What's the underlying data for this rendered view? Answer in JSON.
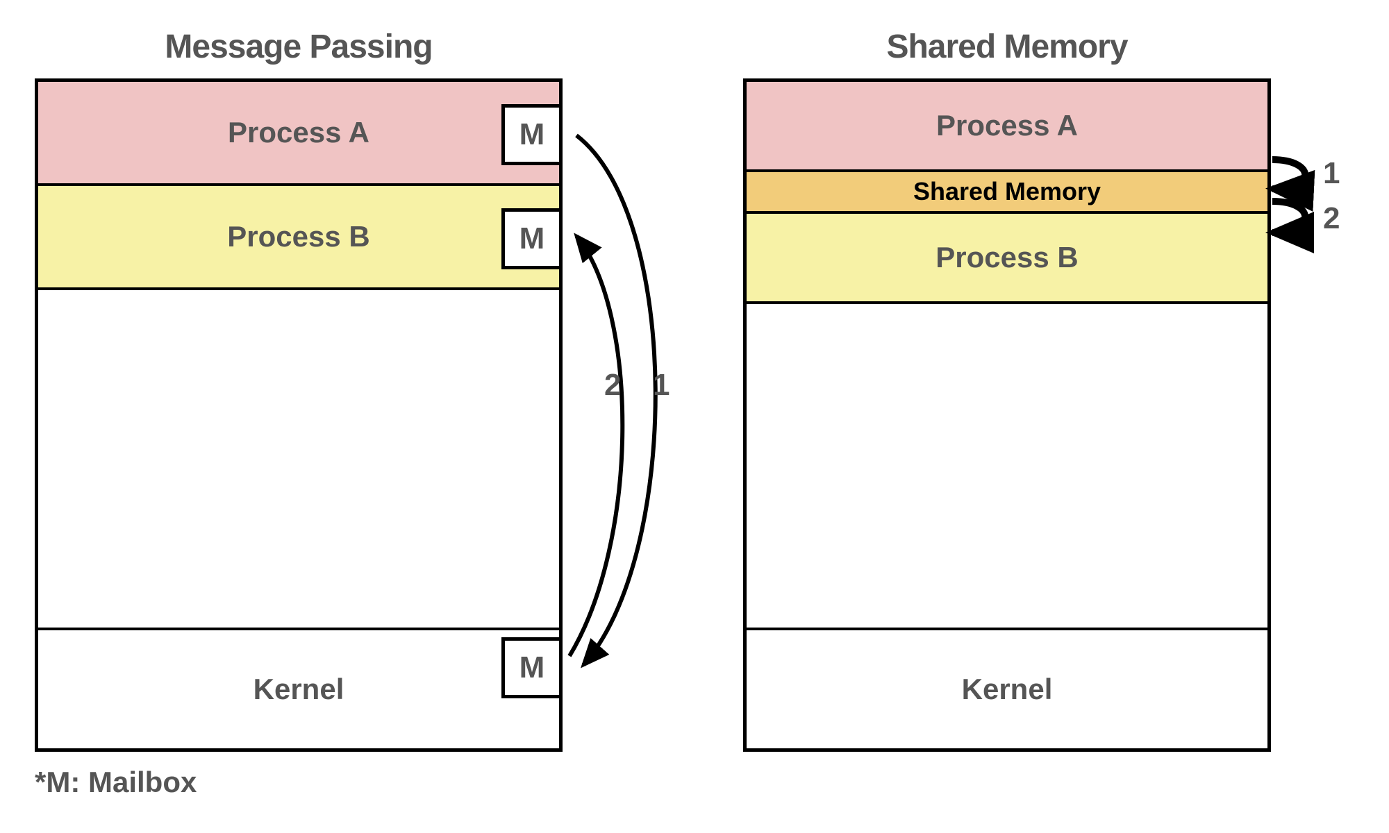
{
  "left": {
    "title": "Message Passing",
    "process_a": "Process A",
    "process_b": "Process B",
    "kernel": "Kernel",
    "mailbox_letter": "M",
    "arrow1": "1",
    "arrow2": "2",
    "footnote": "*M: Mailbox"
  },
  "right": {
    "title": "Shared Memory",
    "process_a": "Process A",
    "shared": "Shared Memory",
    "process_b": "Process B",
    "kernel": "Kernel",
    "arrow1": "1",
    "arrow2": "2"
  }
}
